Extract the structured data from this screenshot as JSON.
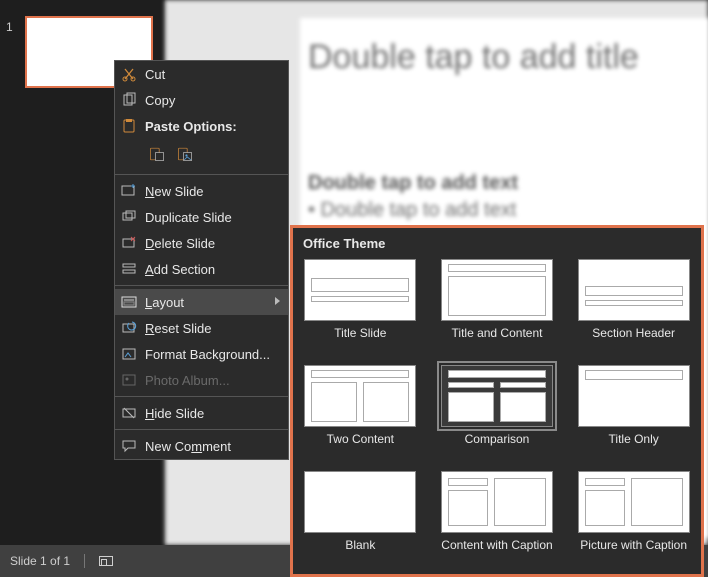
{
  "thumb_strip": {
    "slide_number": "1"
  },
  "editor": {
    "title_placeholder": "Double tap to add title",
    "body_header": "Double tap to add text",
    "body_bullet": "• Double tap to add text"
  },
  "status": {
    "slide_counter": "Slide 1 of 1"
  },
  "ctx": {
    "cut": "Cut",
    "copy": "Copy",
    "paste_header": "Paste Options:",
    "new_slide": "New Slide",
    "duplicate": "Duplicate Slide",
    "delete": "Delete Slide",
    "add_section": "Add Section",
    "layout": "Layout",
    "reset": "Reset Slide",
    "format_bg": "Format Background...",
    "photo_album": "Photo Album...",
    "hide": "Hide Slide",
    "new_comment": "New Comment"
  },
  "flyout": {
    "heading": "Office Theme",
    "items": [
      {
        "label": "Title Slide",
        "klass": "L-titleslide",
        "sel": false
      },
      {
        "label": "Title and Content",
        "klass": "L-titlecontent",
        "sel": false
      },
      {
        "label": "Section Header",
        "klass": "L-section",
        "sel": false
      },
      {
        "label": "Two Content",
        "klass": "L-two",
        "sel": false
      },
      {
        "label": "Comparison",
        "klass": "L-comp",
        "sel": true
      },
      {
        "label": "Title Only",
        "klass": "L-titleonly",
        "sel": false
      },
      {
        "label": "Blank",
        "klass": "L-blank",
        "sel": false
      },
      {
        "label": "Content with Caption",
        "klass": "L-cwc",
        "sel": false
      },
      {
        "label": "Picture with Caption",
        "klass": "L-pwc",
        "sel": false
      }
    ]
  }
}
